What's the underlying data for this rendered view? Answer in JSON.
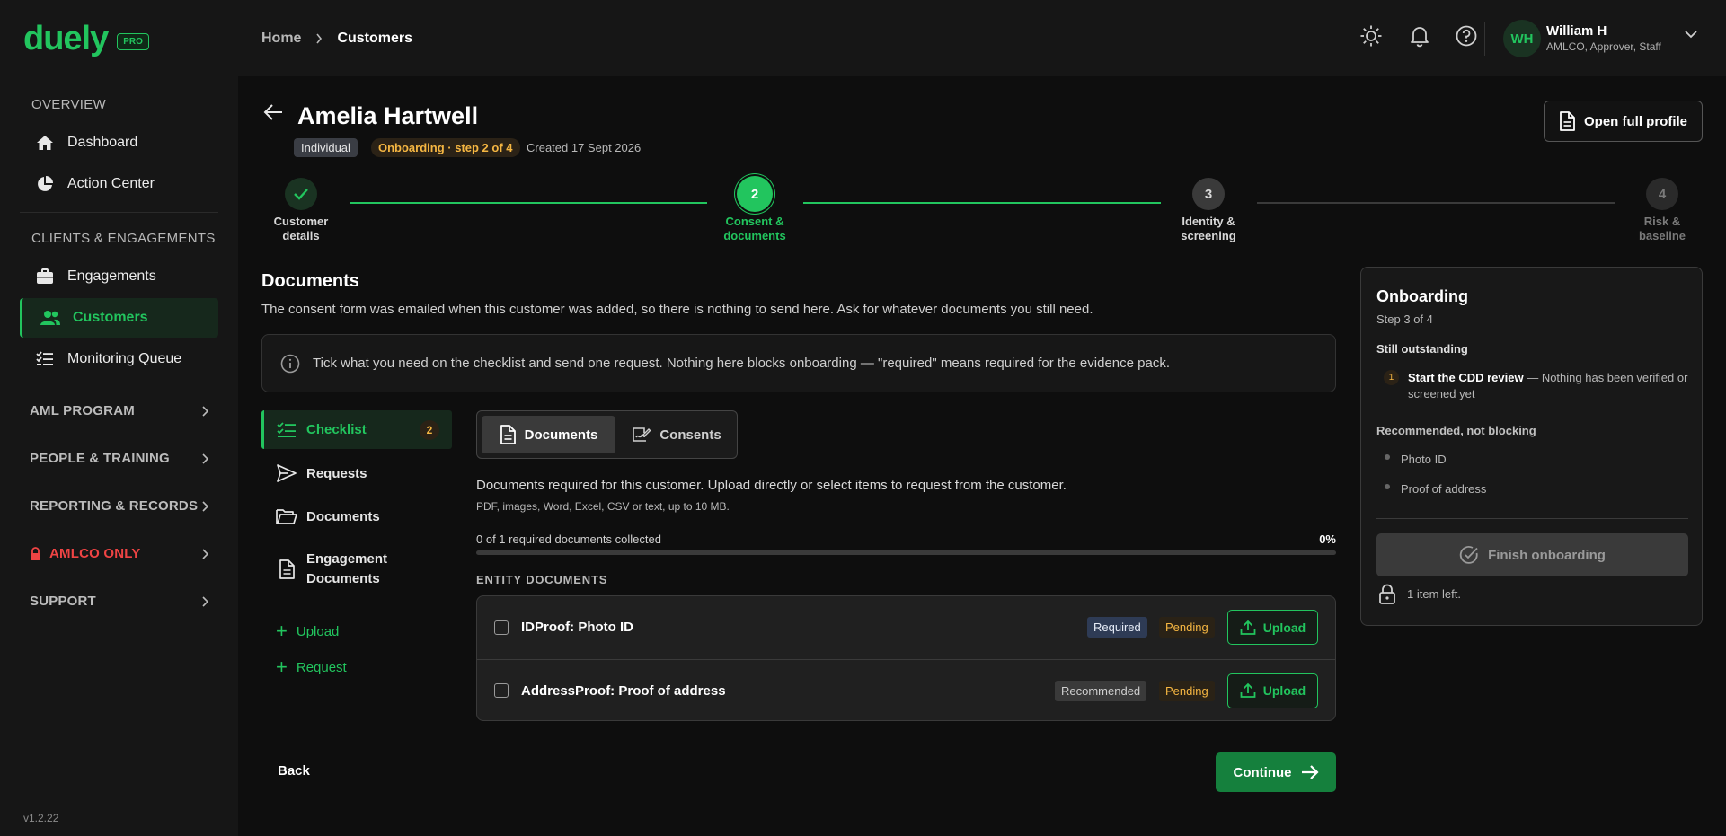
{
  "brand": {
    "name": "duely",
    "badge": "PRO"
  },
  "sidebar": {
    "overview_title": "OVERVIEW",
    "overview_items": [
      {
        "label": "Dashboard",
        "icon": "home-icon"
      },
      {
        "label": "Action Center",
        "icon": "pie-chart-icon"
      }
    ],
    "clients_title": "CLIENTS & ENGAGEMENTS",
    "clients_items": [
      {
        "label": "Engagements",
        "icon": "briefcase-icon"
      },
      {
        "label": "Customers",
        "icon": "users-icon",
        "active": true
      },
      {
        "label": "Monitoring Queue",
        "icon": "list-check-icon"
      }
    ],
    "groups": [
      {
        "label": "AML PROGRAM"
      },
      {
        "label": "PEOPLE & TRAINING"
      },
      {
        "label": "REPORTING & RECORDS"
      },
      {
        "label": "AMLCO ONLY",
        "color": "#ef4444"
      },
      {
        "label": "SUPPORT"
      }
    ],
    "version": "v1.2.22"
  },
  "topbar": {
    "breadcrumb": {
      "home": "Home",
      "current": "Customers"
    },
    "user": {
      "initials": "WH",
      "name": "William H",
      "roles": "AMLCO, Approver, Staff"
    }
  },
  "customer": {
    "name": "Amelia Hartwell",
    "type_chip": "Individual",
    "status_chip": "Onboarding · step 2 of 4",
    "created": "Created 17 Sept 2026",
    "open_profile_label": "Open full profile"
  },
  "stepper": {
    "steps": [
      {
        "number": "1",
        "line1": "Customer",
        "line2": "details",
        "state": "done"
      },
      {
        "number": "2",
        "line1": "Consent &",
        "line2": "documents",
        "state": "current"
      },
      {
        "number": "3",
        "line1": "Identity &",
        "line2": "screening",
        "state": "todo"
      },
      {
        "number": "4",
        "line1": "Risk &",
        "line2": "baseline",
        "state": "todo"
      }
    ]
  },
  "documents": {
    "title": "Documents",
    "description": "The consent form was emailed when this customer was added, so there is nothing to send here. Ask for whatever documents you still need.",
    "info": "Tick what you need on the checklist and send one request. Nothing here blocks onboarding — \"required\" means required for the evidence pack.",
    "left_menu": [
      {
        "label": "Checklist",
        "icon": "checklist-icon",
        "badge": "2",
        "active": true
      },
      {
        "label": "Requests",
        "icon": "send-icon"
      },
      {
        "label": "Documents",
        "icon": "folder-icon"
      },
      {
        "label": "Engagement Documents",
        "icon": "file-text-icon"
      }
    ],
    "actions": {
      "upload": "Upload",
      "request": "Request"
    },
    "tabs": {
      "documents": "Documents",
      "consents": "Consents"
    },
    "required_desc": "Documents required for this customer. Upload directly or select items to request from the customer.",
    "file_types": "PDF, images, Word, Excel, CSV or text, up to 10 MB.",
    "progress_label": "0 of 1 required documents collected",
    "progress_pct": "0%",
    "progress_value": 0,
    "entity_label": "ENTITY DOCUMENTS",
    "rows": [
      {
        "name": "IDProof: Photo ID",
        "tag": "Required",
        "status": "Pending",
        "upload": "Upload"
      },
      {
        "name": "AddressProof: Proof of address",
        "tag": "Recommended",
        "status": "Pending",
        "upload": "Upload"
      }
    ],
    "back_label": "Back",
    "continue_label": "Continue"
  },
  "panel": {
    "title": "Onboarding",
    "step": "Step 3 of 4",
    "outstanding_title": "Still outstanding",
    "outstanding_num": "1",
    "outstanding_bold": "Start the CDD review",
    "outstanding_rest": " — Nothing has been verified or screened yet",
    "recommended_title": "Recommended, not blocking",
    "recommended_items": [
      "Photo ID",
      "Proof of address"
    ],
    "finish_label": "Finish onboarding",
    "items_left": "1 item left."
  },
  "colors": {
    "accent": "#22c55e",
    "warning": "#f5b642",
    "danger": "#ef4444"
  }
}
